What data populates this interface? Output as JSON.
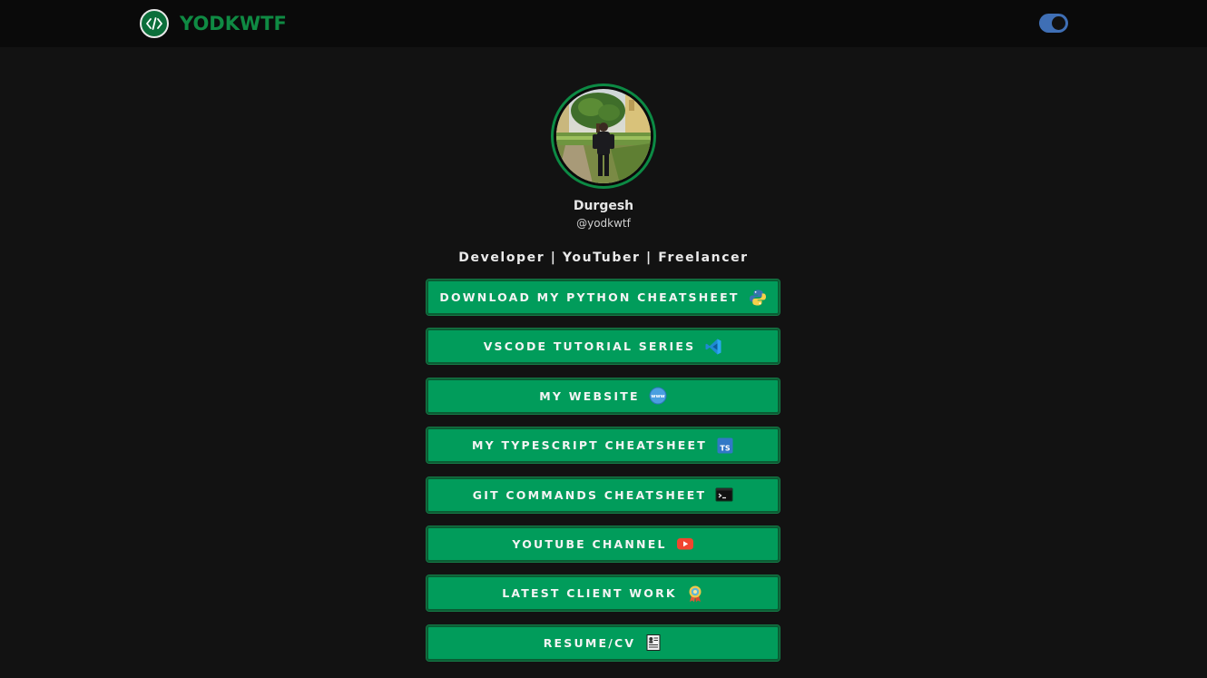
{
  "navbar": {
    "brand_name": "YODKWTF",
    "logo_icon": "code-brackets-icon",
    "theme_toggle": {
      "state": "on",
      "color": "#3f6fb5"
    }
  },
  "profile": {
    "name": "Durgesh",
    "handle": "@yodkwtf",
    "avatar_icon": "profile-photo"
  },
  "tagline": "Developer | YouTuber | Freelancer",
  "colors": {
    "background": "#121212",
    "button": "#019c5b",
    "brand": "#0f8a43"
  },
  "links": [
    {
      "label": "DOWNLOAD MY PYTHON CHEATSHEET",
      "icon": "python-icon"
    },
    {
      "label": "VSCODE TUTORIAL SERIES",
      "icon": "vscode-icon"
    },
    {
      "label": "MY WEBSITE",
      "icon": "globe-icon"
    },
    {
      "label": "MY TYPESCRIPT CHEATSHEET",
      "icon": "typescript-icon"
    },
    {
      "label": "GIT COMMANDS CHEATSHEET",
      "icon": "terminal-icon"
    },
    {
      "label": "YOUTUBE CHANNEL",
      "icon": "youtube-icon"
    },
    {
      "label": "LATEST CLIENT WORK",
      "icon": "award-icon"
    },
    {
      "label": "RESUME/CV",
      "icon": "resume-icon"
    }
  ]
}
